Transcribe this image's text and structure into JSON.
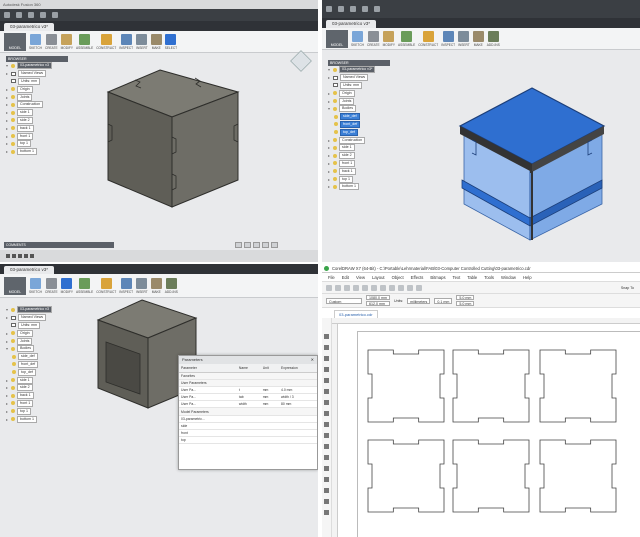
{
  "fusion": {
    "window_title": "Autodesk Fusion 360",
    "doc_tab": "03-parametrico v3*",
    "workspace": "MODEL",
    "ribbon": [
      "SKETCH",
      "CREATE",
      "MODIFY",
      "ASSEMBLE",
      "CONSTRUCT",
      "INSPECT",
      "INSERT",
      "MAKE",
      "ADD-INS",
      "SELECT"
    ],
    "browser_title": "BROWSER",
    "browser_q1": [
      "03-parametrico v3",
      "Named Views",
      "Units: mm",
      "Origin",
      "Joints",
      "Construction",
      "side 1",
      "side 2",
      "back 1",
      "front 1",
      "top 1",
      "bottom 1"
    ],
    "browser_q2": [
      "03-parametrico v3*",
      "Named Views",
      "Units: mm",
      "Origin",
      "Joints",
      "Bodies",
      "side_def",
      "front_def",
      "top_def",
      "Construction",
      "side 1",
      "side 2",
      "front 1",
      "back 1",
      "top 1",
      "bottom 1"
    ],
    "browser_q3": [
      "03-parametrico v3",
      "Named Views",
      "Units: mm",
      "Origin",
      "Joints",
      "Bodies",
      "side_def",
      "front_def",
      "top_def",
      "side 1",
      "side 2",
      "back 1",
      "front 1",
      "top 1",
      "bottom 1"
    ],
    "comments_label": "COMMENTS",
    "colors": {
      "box_gray": "#6b6a63",
      "box_blue": "#2f6fd0",
      "box_blue_light": "#8fb7ef"
    }
  },
  "parameters_dialog": {
    "title": "Parameters",
    "columns": [
      "Parameter",
      "Name",
      "Unit",
      "Expression"
    ],
    "rows": [
      {
        "c1": "Favorites",
        "c2": "",
        "c3": "",
        "c4": "",
        "section": true
      },
      {
        "c1": "User Parameters",
        "c2": "",
        "c3": "",
        "c4": "",
        "section": true
      },
      {
        "c1": "User Pa...",
        "c2": "t",
        "c3": "mm",
        "c4": "4.0 mm",
        "section": false
      },
      {
        "c1": "User Pa...",
        "c2": "tab",
        "c3": "mm",
        "c4": "width / 3",
        "section": false
      },
      {
        "c1": "User Pa...",
        "c2": "width",
        "c3": "mm",
        "c4": "80 mm",
        "section": false
      },
      {
        "c1": "Model Parameters",
        "c2": "",
        "c3": "",
        "c4": "",
        "section": true
      },
      {
        "c1": "03-parametric...",
        "c2": "",
        "c3": "",
        "c4": "",
        "section": false
      },
      {
        "c1": "side",
        "c2": "",
        "c3": "",
        "c4": "",
        "section": false
      },
      {
        "c1": "front",
        "c2": "",
        "c3": "",
        "c4": "",
        "section": false
      },
      {
        "c1": "top",
        "c2": "",
        "c3": "",
        "c4": "",
        "section": false
      }
    ]
  },
  "corel": {
    "title": "CorelDRAW X7 (64-Bit) - C:\\Portable\\Lehrmaterial\\FAB\\03-Computer Controlled Cutting\\03-parametrico.cdr",
    "menu": [
      "File",
      "Edit",
      "View",
      "Layout",
      "Object",
      "Effects",
      "Bitmaps",
      "Text",
      "Table",
      "Tools",
      "Window",
      "Help"
    ],
    "preset": "Custom",
    "width_value": "1080.0 mm",
    "height_value": "612.0 mm",
    "units_label": "Units:",
    "units_value": "millimeters",
    "nudge": "0.1 mm",
    "dup_x": "5.0 mm",
    "dup_y": "5.0 mm",
    "snap": "Snap To",
    "doc_tab": "03-parametrico.cdr"
  }
}
